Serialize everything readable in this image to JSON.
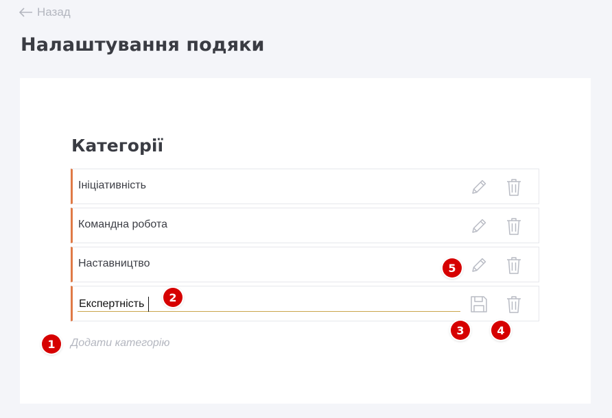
{
  "nav": {
    "back_label": "Назад",
    "back_icon": "arrow-left-icon"
  },
  "page": {
    "title": "Налаштування подяки"
  },
  "categories": {
    "title": "Категорії",
    "accent_color": "#e07a46",
    "items": [
      {
        "label": "Ініціативність",
        "actions": [
          "pencil-icon",
          "trash-icon"
        ]
      },
      {
        "label": "Командна робота",
        "actions": [
          "pencil-icon",
          "trash-icon"
        ]
      },
      {
        "label": "Наставництво",
        "actions": [
          "pencil-icon",
          "trash-icon"
        ]
      },
      {
        "value": "Експертність",
        "editing": true,
        "actions": [
          "save-icon",
          "trash-icon"
        ]
      }
    ],
    "add_label": "Додати категорію"
  },
  "markers": {
    "m1": "1",
    "m2": "2",
    "m3": "3",
    "m4": "4",
    "m5": "5"
  },
  "colors": {
    "background": "#f4f5f9",
    "card": "#ffffff",
    "marker": "#d60000",
    "icon": "#b8bbc4"
  }
}
